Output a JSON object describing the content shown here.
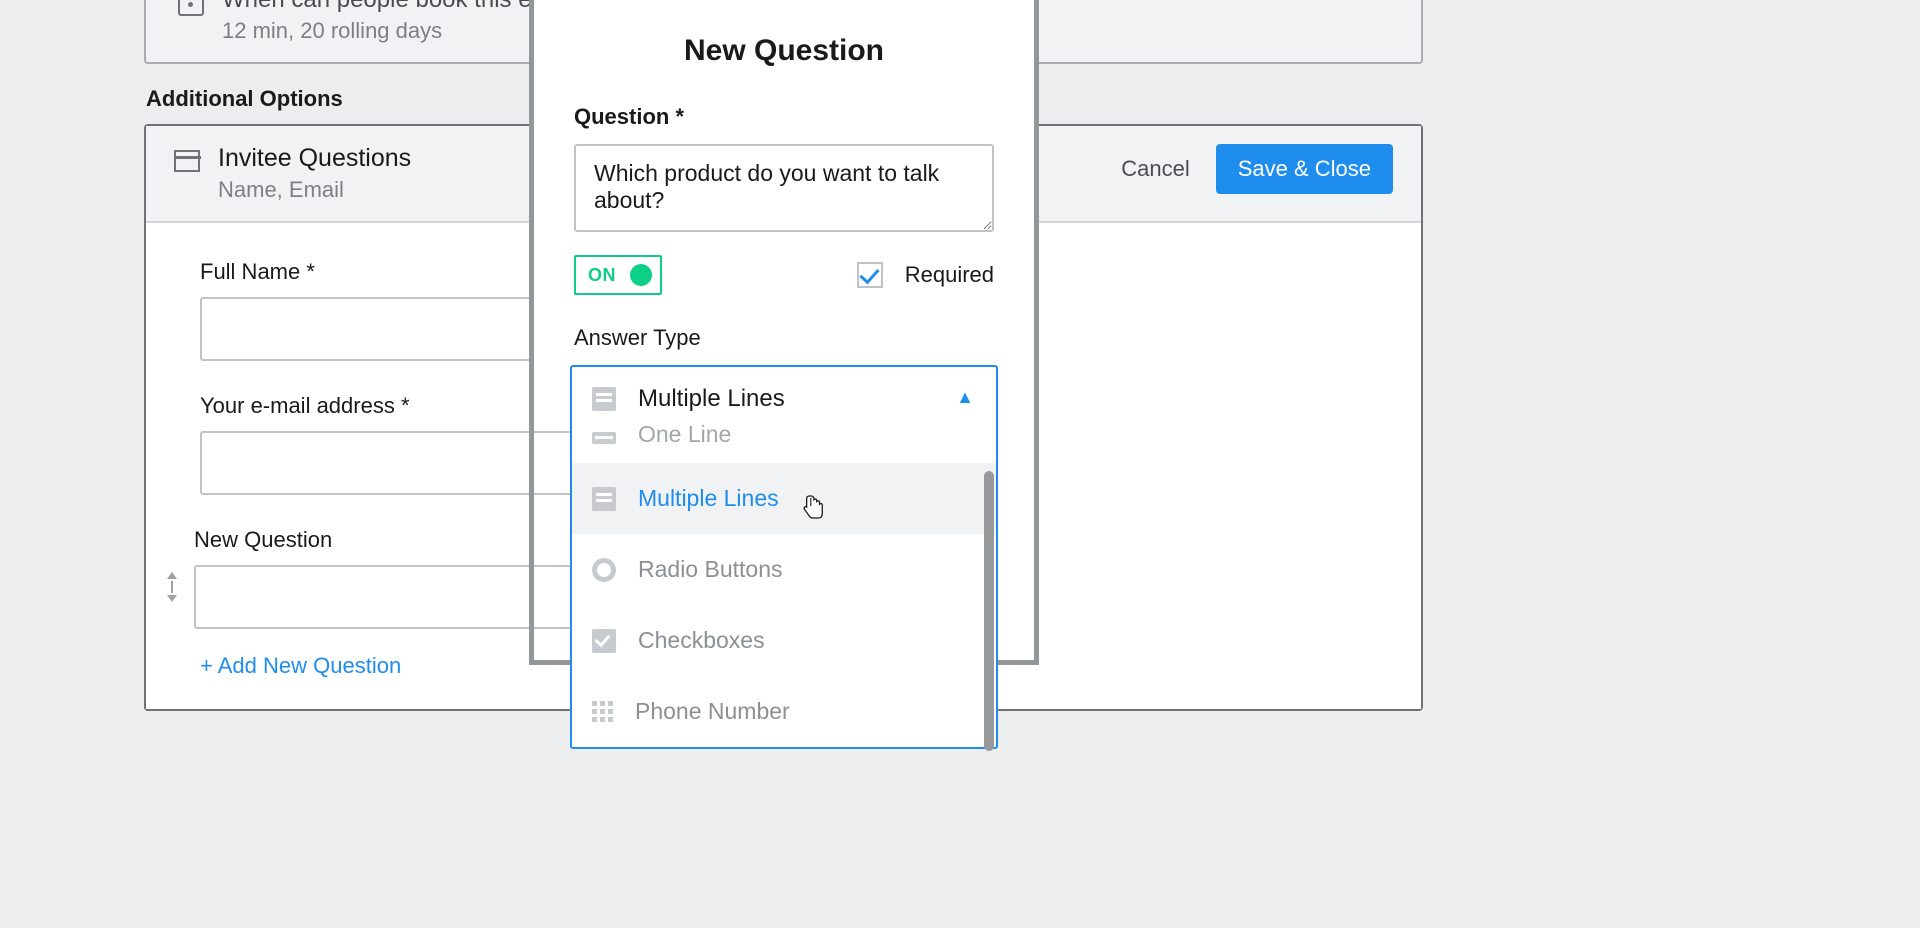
{
  "bg": {
    "booking_section": {
      "title": "When can people book this event?",
      "subtitle": "12 min, 20 rolling days"
    },
    "additional_options_label": "Additional Options",
    "invitee_questions": {
      "title": "Invitee Questions",
      "subtitle": "Name, Email",
      "cancel_label": "Cancel",
      "save_label": "Save & Close",
      "fields": {
        "full_name_label": "Full Name *",
        "email_label": "Your e-mail address *",
        "new_question_label": "New Question"
      },
      "add_new_question": "+ Add New Question"
    }
  },
  "modal": {
    "title": "New Question",
    "question_label": "Question *",
    "question_value": "Which product do you want to talk about?",
    "toggle_label": "ON",
    "required_label": "Required",
    "answer_type_label": "Answer Type",
    "selected_answer_type": "Multiple Lines",
    "secondary_line": "One Line",
    "options": {
      "one_line": "One Line",
      "multiple_lines": "Multiple Lines",
      "radio": "Radio Buttons",
      "checkboxes": "Checkboxes",
      "phone": "Phone Number"
    }
  }
}
